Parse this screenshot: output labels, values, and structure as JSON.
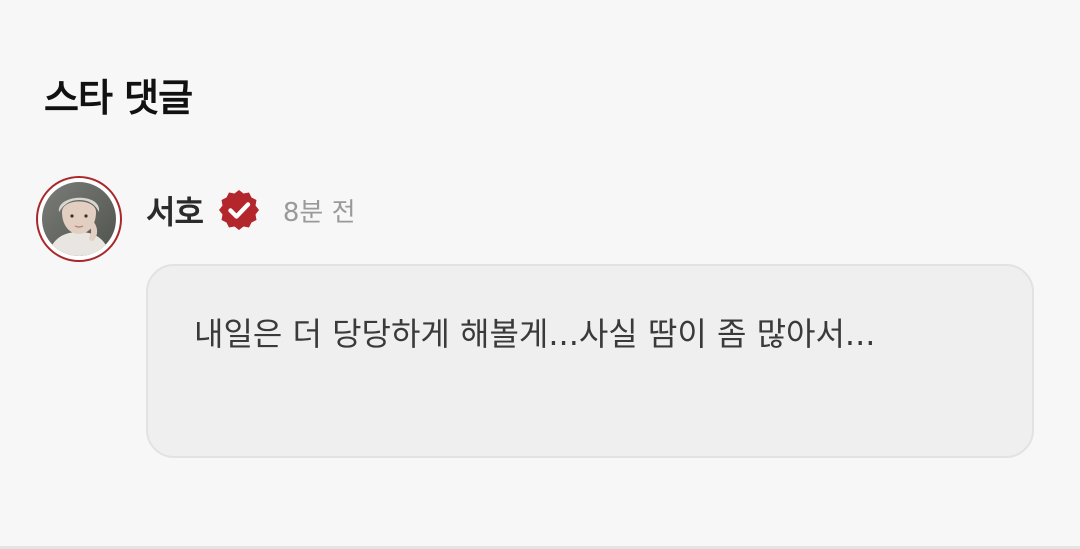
{
  "section": {
    "title": "스타 댓글"
  },
  "comment": {
    "author": "서호",
    "verified_icon": "verified-badge-icon",
    "time_ago": "8분 전",
    "text": "내일은 더 당당하게 해볼게...사실 땀이 좀 많아서...",
    "colors": {
      "badge": "#b3262b",
      "avatar_ring": "#a8282c",
      "bubble_bg": "#efefef"
    }
  }
}
